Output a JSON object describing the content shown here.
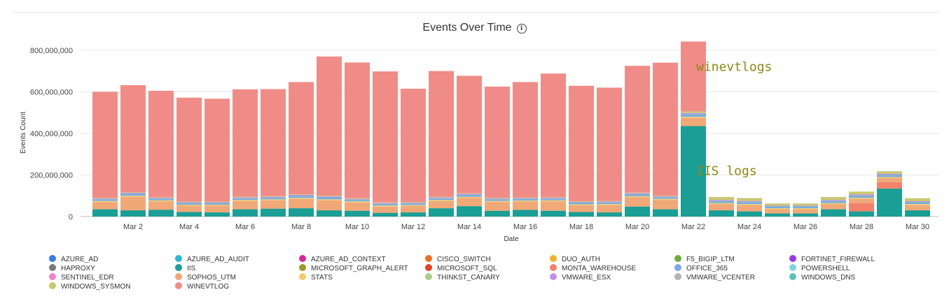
{
  "chart_data": {
    "type": "bar",
    "stacked": true,
    "title": "Events Over Time",
    "xlabel": "Date",
    "ylabel": "Events Count",
    "ylim": [
      0,
      850000000
    ],
    "yticks": [
      0,
      200000000,
      400000000,
      600000000,
      800000000
    ],
    "ytick_labels": [
      "0",
      "200,000,000",
      "400,000,000",
      "600,000,000",
      "800,000,000"
    ],
    "xtick_labels": [
      "Mar 2",
      "Mar 4",
      "Mar 6",
      "Mar 8",
      "Mar 10",
      "Mar 12",
      "Mar 14",
      "Mar 16",
      "Mar 18",
      "Mar 20",
      "Mar 22",
      "Mar 24",
      "Mar 26",
      "Mar 28",
      "Mar 30"
    ],
    "categories": [
      "Mar 1",
      "Mar 2",
      "Mar 3",
      "Mar 4",
      "Mar 5",
      "Mar 6",
      "Mar 7",
      "Mar 8",
      "Mar 9",
      "Mar 10",
      "Mar 11",
      "Mar 12",
      "Mar 13",
      "Mar 14",
      "Mar 15",
      "Mar 16",
      "Mar 17",
      "Mar 18",
      "Mar 19",
      "Mar 20",
      "Mar 21",
      "Mar 22",
      "Mar 23",
      "Mar 24",
      "Mar 25",
      "Mar 26",
      "Mar 27",
      "Mar 28",
      "Mar 29",
      "Mar 30"
    ],
    "grid": true,
    "legend_position": "bottom",
    "series": [
      {
        "name": "IIS",
        "color": "#1a9e96",
        "values": [
          35000000,
          30000000,
          33000000,
          22000000,
          20000000,
          35000000,
          38000000,
          40000000,
          30000000,
          28000000,
          18000000,
          20000000,
          40000000,
          50000000,
          28000000,
          32000000,
          28000000,
          22000000,
          20000000,
          48000000,
          35000000,
          435000000,
          30000000,
          25000000,
          15000000,
          15000000,
          35000000,
          25000000,
          135000000,
          30000000
        ]
      },
      {
        "name": "MONTA_WAREHOUSE",
        "color": "#f2826b",
        "values": [
          0,
          0,
          0,
          0,
          0,
          0,
          0,
          0,
          0,
          0,
          0,
          0,
          0,
          0,
          0,
          0,
          0,
          0,
          0,
          0,
          0,
          0,
          0,
          0,
          0,
          0,
          0,
          40000000,
          30000000,
          0
        ]
      },
      {
        "name": "SOPHOS_UTM",
        "color": "#f0a878",
        "values": [
          35000000,
          65000000,
          40000000,
          30000000,
          32000000,
          40000000,
          40000000,
          45000000,
          48000000,
          40000000,
          30000000,
          30000000,
          35000000,
          40000000,
          42000000,
          40000000,
          45000000,
          32000000,
          35000000,
          45000000,
          45000000,
          40000000,
          30000000,
          30000000,
          20000000,
          20000000,
          25000000,
          20000000,
          20000000,
          25000000
        ]
      },
      {
        "name": "STATS",
        "color": "#f2cc6b",
        "values": [
          5000000,
          5000000,
          5000000,
          5000000,
          5000000,
          5000000,
          5000000,
          5000000,
          5000000,
          5000000,
          5000000,
          5000000,
          5000000,
          5000000,
          5000000,
          5000000,
          5000000,
          5000000,
          5000000,
          5000000,
          5000000,
          5000000,
          5000000,
          5000000,
          5000000,
          5000000,
          5000000,
          5000000,
          5000000,
          5000000
        ]
      },
      {
        "name": "OFFICE_365",
        "color": "#7ba6e8",
        "values": [
          5000000,
          6000000,
          5000000,
          5000000,
          5000000,
          5000000,
          5000000,
          6000000,
          6000000,
          5000000,
          5000000,
          5000000,
          5000000,
          6000000,
          5000000,
          5000000,
          5000000,
          5000000,
          5000000,
          6000000,
          5000000,
          8000000,
          6000000,
          6000000,
          5000000,
          5000000,
          6000000,
          6000000,
          6000000,
          5000000
        ]
      },
      {
        "name": "WINDOWS_DNS",
        "color": "#5cc0b4",
        "values": [
          3000000,
          3000000,
          3000000,
          3000000,
          3000000,
          3000000,
          3000000,
          3000000,
          3000000,
          3000000,
          3000000,
          3000000,
          3000000,
          3000000,
          3000000,
          3000000,
          3000000,
          3000000,
          3000000,
          3000000,
          3000000,
          4000000,
          4000000,
          4000000,
          4000000,
          4000000,
          4000000,
          4000000,
          4000000,
          4000000
        ]
      },
      {
        "name": "VMWARE_ESX",
        "color": "#c08fe8",
        "values": [
          4000000,
          5000000,
          4000000,
          4000000,
          4000000,
          4000000,
          4000000,
          5000000,
          5000000,
          4000000,
          4000000,
          4000000,
          4000000,
          5000000,
          4000000,
          4000000,
          4000000,
          4000000,
          4000000,
          5000000,
          4000000,
          6000000,
          5000000,
          5000000,
          4000000,
          4000000,
          5000000,
          6000000,
          6000000,
          5000000
        ]
      },
      {
        "name": "WINDOWS_SYSMON",
        "color": "#c8c871",
        "values": [
          3000000,
          3000000,
          3000000,
          3000000,
          3000000,
          3000000,
          3000000,
          3000000,
          3000000,
          3000000,
          3000000,
          3000000,
          3000000,
          3000000,
          3000000,
          3000000,
          3000000,
          3000000,
          3000000,
          3000000,
          3000000,
          8000000,
          14000000,
          14000000,
          10000000,
          10000000,
          14000000,
          14000000,
          12000000,
          14000000
        ]
      },
      {
        "name": "WINEVTLOG",
        "color": "#f08c87",
        "values": [
          510000000,
          515000000,
          512000000,
          500000000,
          495000000,
          517000000,
          515000000,
          540000000,
          670000000,
          653000000,
          630000000,
          545000000,
          605000000,
          565000000,
          535000000,
          555000000,
          595000000,
          555000000,
          545000000,
          610000000,
          640000000,
          336000000,
          0,
          0,
          0,
          0,
          0,
          0,
          0,
          0
        ]
      }
    ],
    "annotations": [
      {
        "text": "winevtlogs",
        "x": "Mar 22",
        "y": 700000000
      },
      {
        "text": "IIS logs",
        "x": "Mar 22",
        "y": 200000000
      }
    ]
  },
  "legend": [
    {
      "name": "AZURE_AD",
      "color": "#3a7be8"
    },
    {
      "name": "AZURE_AD_AUDIT",
      "color": "#2bb8d8"
    },
    {
      "name": "AZURE_AD_CONTEXT",
      "color": "#d4289a"
    },
    {
      "name": "CISCO_SWITCH",
      "color": "#e8712a"
    },
    {
      "name": "DUO_AUTH",
      "color": "#f2b12a"
    },
    {
      "name": "F5_BIGIP_LTM",
      "color": "#72ac3c"
    },
    {
      "name": "FORTINET_FIREWALL",
      "color": "#9a3ae0"
    },
    {
      "name": "HAPROXY",
      "color": "#7a7a7a"
    },
    {
      "name": "IIS",
      "color": "#1a9e96"
    },
    {
      "name": "MICROSOFT_GRAPH_ALERT",
      "color": "#a09a2a"
    },
    {
      "name": "MICROSOFT_SQL",
      "color": "#e2432e"
    },
    {
      "name": "MONTA_WAREHOUSE",
      "color": "#f2826b"
    },
    {
      "name": "OFFICE_365",
      "color": "#7ba6e8"
    },
    {
      "name": "POWERSHELL",
      "color": "#7fd3df"
    },
    {
      "name": "SENTINEL_EDR",
      "color": "#ee84c8"
    },
    {
      "name": "SOPHOS_UTM",
      "color": "#f0a878"
    },
    {
      "name": "STATS",
      "color": "#f2cc6b"
    },
    {
      "name": "THINKST_CANARY",
      "color": "#a8cf8c"
    },
    {
      "name": "VMWARE_ESX",
      "color": "#c08fe8"
    },
    {
      "name": "VMWARE_VCENTER",
      "color": "#b4b4b4"
    },
    {
      "name": "WINDOWS_DNS",
      "color": "#5cc0b4"
    },
    {
      "name": "WINDOWS_SYSMON",
      "color": "#c8c871"
    },
    {
      "name": "WINEVTLOG",
      "color": "#f08c87"
    }
  ]
}
